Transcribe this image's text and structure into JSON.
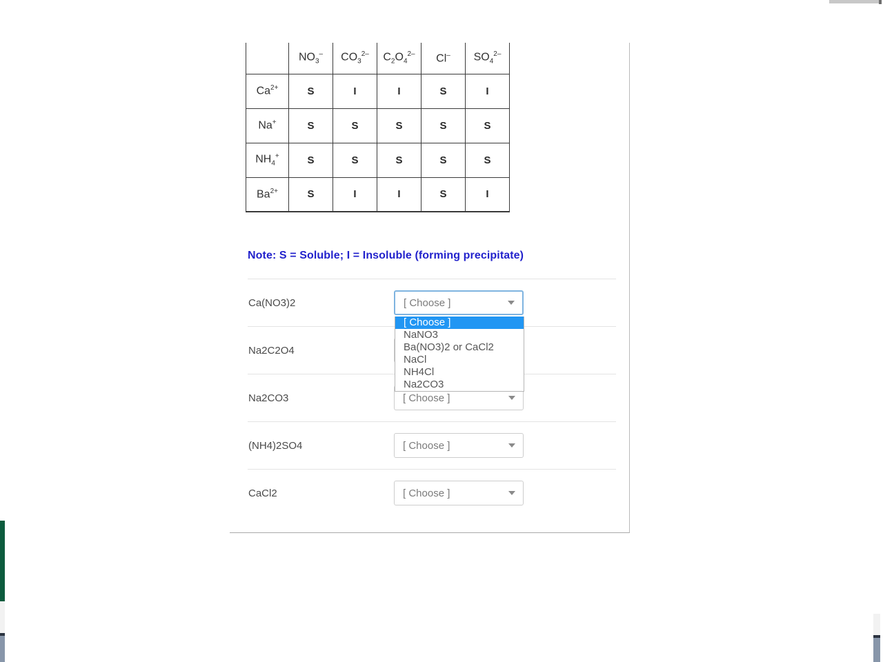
{
  "solubility_table": {
    "corner_label": "",
    "columns": [
      {
        "formula": "NO",
        "sub": "3",
        "sup": "–"
      },
      {
        "formula": "CO",
        "sub": "3",
        "sup": "2–"
      },
      {
        "formula": "C₂O",
        "sub": "4",
        "sup": "2–"
      },
      {
        "formula": "Cl",
        "sub": "",
        "sup": "–"
      },
      {
        "formula": "SO",
        "sub": "4",
        "sup": "2–"
      }
    ],
    "column_labels": [
      "NO3-",
      "CO3 2-",
      "C2O4 2-",
      "Cl-",
      "SO4 2-"
    ],
    "rows": [
      {
        "cation": "Ca",
        "cation_sup": "2+",
        "values": [
          "S",
          "I",
          "I",
          "S",
          "I"
        ]
      },
      {
        "cation": "Na",
        "cation_sup": "+",
        "values": [
          "S",
          "S",
          "S",
          "S",
          "S"
        ]
      },
      {
        "cation": "NH",
        "cation_sub": "4",
        "cation_sup": "+",
        "values": [
          "S",
          "S",
          "S",
          "S",
          "S"
        ]
      },
      {
        "cation": "Ba",
        "cation_sup": "2+",
        "values": [
          "S",
          "I",
          "I",
          "S",
          "I"
        ]
      }
    ]
  },
  "note": {
    "text": "Note: S = Soluble; I = Insoluble (forming precipitate)",
    "color": "#2222cc"
  },
  "questions": [
    {
      "label": "Ca(NO3)2",
      "selected": "[ Choose ]",
      "open": true
    },
    {
      "label": "Na2C2O4",
      "selected": "[ Choose ]",
      "open": false
    },
    {
      "label": "Na2CO3",
      "selected": "[ Choose ]",
      "open": false
    },
    {
      "label": "(NH4)2SO4",
      "selected": "[ Choose ]",
      "open": false
    },
    {
      "label": "CaCl2",
      "selected": "[ Choose ]",
      "open": false
    }
  ],
  "dropdown": {
    "options": [
      "[ Choose ]",
      "NaNO3",
      "Ba(NO3)2 or CaCl2",
      "NaCl",
      "NH4Cl",
      "Na2CO3"
    ],
    "highlighted_index": 0,
    "highlight_color": "#2196f3"
  }
}
